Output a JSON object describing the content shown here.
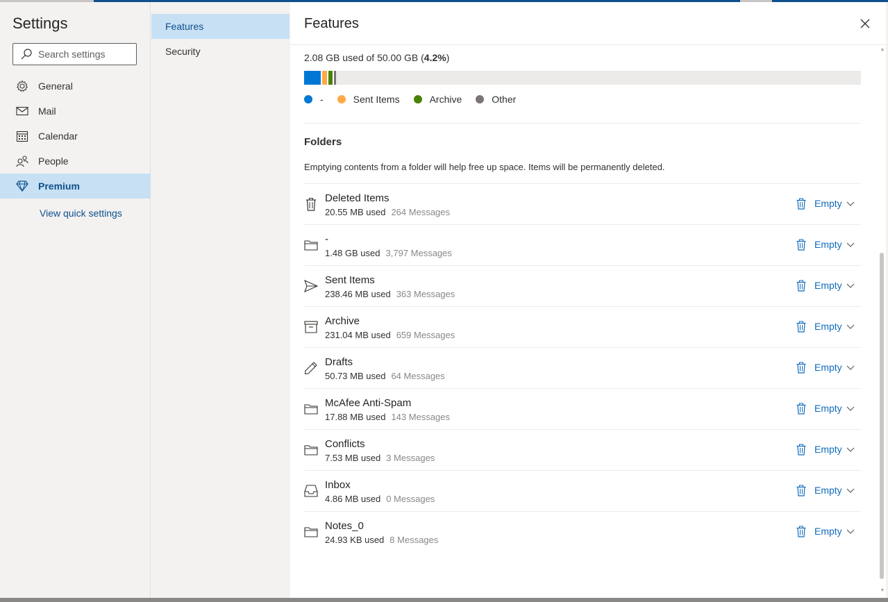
{
  "settings": {
    "title": "Settings",
    "search_placeholder": "Search settings",
    "nav": [
      {
        "label": "General",
        "icon": "gear-icon"
      },
      {
        "label": "Mail",
        "icon": "mail-icon"
      },
      {
        "label": "Calendar",
        "icon": "calendar-icon"
      },
      {
        "label": "People",
        "icon": "people-icon"
      },
      {
        "label": "Premium",
        "icon": "diamond-icon",
        "active": true
      }
    ],
    "quick_settings": "View quick settings"
  },
  "subnav": [
    {
      "label": "Features",
      "active": true
    },
    {
      "label": "Security"
    }
  ],
  "panel": {
    "title": "Features",
    "usage_prefix": "2.08 GB used of 50.00 GB (",
    "usage_percent": "4.2%",
    "usage_suffix": ")",
    "storage_bar": [
      {
        "name": "-",
        "fraction": 0.03,
        "color": "#0078d4"
      },
      {
        "name": "Sent Items",
        "fraction": 0.011,
        "color": "#ffaa44"
      },
      {
        "name": "Archive",
        "fraction": 0.01,
        "color": "#498205"
      },
      {
        "name": "Other",
        "fraction": 0.006,
        "color": "#7a7574"
      }
    ],
    "legend": [
      {
        "label": "-",
        "color": "#0078d4"
      },
      {
        "label": "Sent Items",
        "color": "#ffaa44"
      },
      {
        "label": "Archive",
        "color": "#498205"
      },
      {
        "label": "Other",
        "color": "#7a7574"
      }
    ],
    "folders_heading": "Folders",
    "folders_description": "Emptying contents from a folder will help free up space. Items will be permanently deleted.",
    "empty_label": "Empty",
    "folders": [
      {
        "name": "Deleted Items",
        "size": "20.55 MB used",
        "messages": "264 Messages",
        "icon": "trash-icon"
      },
      {
        "name": "-",
        "size": "1.48 GB used",
        "messages": "3,797 Messages",
        "icon": "folder-icon"
      },
      {
        "name": "Sent Items",
        "size": "238.46 MB used",
        "messages": "363 Messages",
        "icon": "send-icon"
      },
      {
        "name": "Archive",
        "size": "231.04 MB used",
        "messages": "659 Messages",
        "icon": "archive-icon"
      },
      {
        "name": "Drafts",
        "size": "50.73 MB used",
        "messages": "64 Messages",
        "icon": "pencil-icon"
      },
      {
        "name": "McAfee Anti-Spam",
        "size": "17.88 MB used",
        "messages": "143 Messages",
        "icon": "folder-icon"
      },
      {
        "name": "Conflicts",
        "size": "7.53 MB used",
        "messages": "3 Messages",
        "icon": "folder-icon"
      },
      {
        "name": "Inbox",
        "size": "4.86 MB used",
        "messages": "0 Messages",
        "icon": "inbox-icon"
      },
      {
        "name": "Notes_0",
        "size": "24.93 KB used",
        "messages": "8 Messages",
        "icon": "folder-icon"
      }
    ]
  }
}
